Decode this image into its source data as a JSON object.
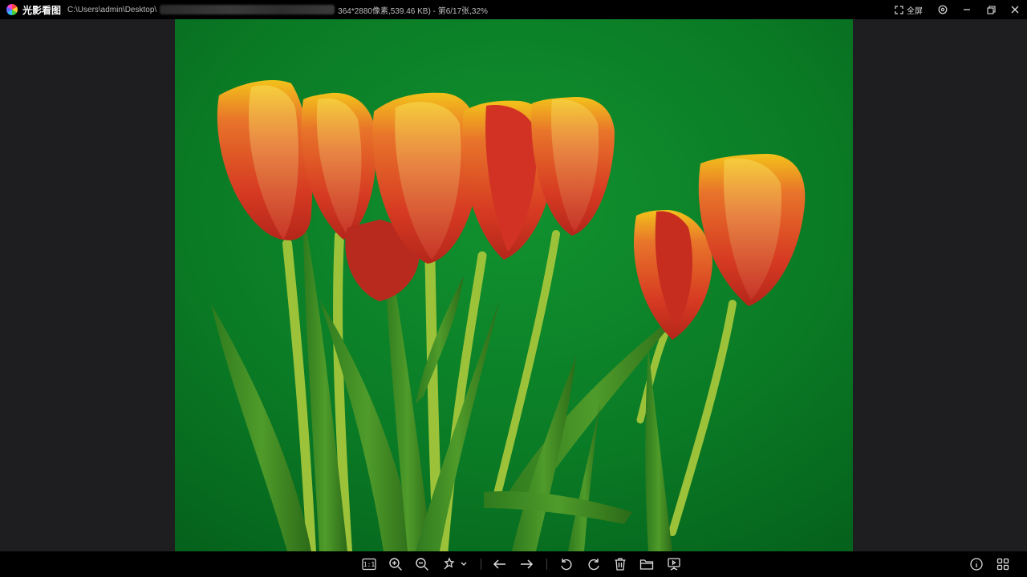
{
  "titlebar": {
    "app_name": "光影看图",
    "path_prefix": "C:\\Users\\admin\\Desktop\\",
    "path_suffix": "364*2880像素,539.46 KB) - 第6/17张,32%",
    "fullscreen_label": "全屏"
  },
  "toolbar": {
    "actual_size_label": "1:1"
  },
  "colors": {
    "titlebar_bg": "#000000",
    "viewer_bg": "#1e1e20",
    "photo_bg": "#0b7a26"
  }
}
